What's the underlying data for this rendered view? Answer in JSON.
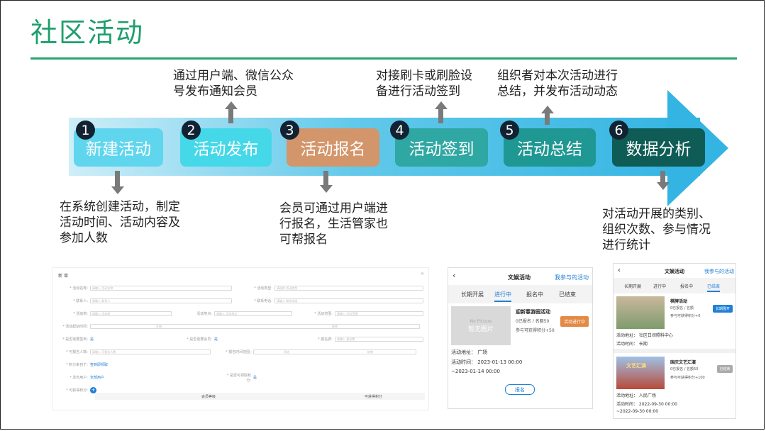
{
  "slide": {
    "title": "社区活动"
  },
  "steps": [
    {
      "num": "1",
      "label": "新建活动",
      "color": "#5fd6ee"
    },
    {
      "num": "2",
      "label": "活动发布",
      "color": "#45d8e8"
    },
    {
      "num": "3",
      "label": "活动报名",
      "color": "#d3956a"
    },
    {
      "num": "4",
      "label": "活动签到",
      "color": "#2fa7a2"
    },
    {
      "num": "5",
      "label": "活动总结",
      "color": "#1f9792"
    },
    {
      "num": "6",
      "label": "数据分析",
      "color": "#0e5c55"
    }
  ],
  "descriptions": {
    "step1": [
      "在系统创建活动，制定",
      "活动时间、活动内容及",
      "参加人数"
    ],
    "step2": [
      "通过用户端、微信公众",
      "号发布通知会员"
    ],
    "step3": [
      "会员可通过用户端进",
      "行报名，生活管家也",
      "可帮报名"
    ],
    "step4": [
      "对接刷卡或刷脸设",
      "备进行活动签到"
    ],
    "step5": [
      "组织者对本次活动进行",
      "总结，并发布活动动态"
    ],
    "step6": [
      "对活动开展的类别、",
      "组织次数、参与情况",
      "进行统计"
    ]
  },
  "form_screenshot": {
    "title": "新 增",
    "fields": [
      {
        "label": "* 活动名称:",
        "placeholder": "请输入 活动名称"
      },
      {
        "label": "* 活动类型:",
        "placeholder": "请选择 活动类型"
      },
      {
        "label": "* 联系人:",
        "placeholder": "请输入 联系人"
      },
      {
        "label": "* 联系电话:",
        "placeholder": "请输入 联系电话"
      },
      {
        "label": "* 活动地:",
        "placeholder": "请输入 活动地"
      },
      {
        "label": "活动地点:",
        "placeholder": "请输入 活动地点"
      },
      {
        "label": "* 活动范围:",
        "placeholder": "请输入 活动范围"
      },
      {
        "label": "* 活动起始时间:",
        "placeholder": "开始"
      },
      {
        "label": "",
        "placeholder": "结束"
      },
      {
        "label": "* 是否需要签到:",
        "placeholder": "是"
      },
      {
        "label": "* 是否需要会员:",
        "placeholder": "是"
      },
      {
        "label": "* 报名费:",
        "placeholder": "请输入 报名费"
      },
      {
        "label": "* 可报名人数:",
        "placeholder": "请输入 可报名人数"
      },
      {
        "label": "* 报名时间范围:",
        "placeholder": "开始"
      },
      {
        "label": "",
        "placeholder": "结束"
      },
      {
        "label": "* 积分来自于:",
        "placeholder": "签到即领取"
      },
      {
        "label": "* 发布用户:",
        "placeholder": "全部用户"
      },
      {
        "label": "* 是否可领取积分:",
        "placeholder": "是"
      },
      {
        "label": "* 可获得积分:",
        "placeholder": ""
      }
    ],
    "table_headers": [
      "会员等级",
      "可获得积分"
    ]
  },
  "mobile1": {
    "header": "文娱活动",
    "link": "我参与的活动",
    "tabs": [
      "长期开展",
      "进行中",
      "报名中",
      "已结束"
    ],
    "active_tab": 1,
    "nopic_en": "No Picture",
    "nopic_cn": "暂无图片",
    "card_title": "迎新春游园活动",
    "card_count": "0已报名 / 名额50",
    "card_points": "参与可获得积分+50",
    "status": "活动进行中",
    "address": "活动地址：  广场",
    "time": "活动时间：  2023-01-13 00:00",
    "time_end": "~2023-01-14 00:00",
    "button": "报名"
  },
  "mobile2": {
    "header": "文娱活动",
    "link": "我参与的活动",
    "tabs": [
      "长期开展",
      "进行中",
      "报名中",
      "已结束"
    ],
    "active_tab": 3,
    "card1_title": "棋牌活动",
    "card1_count": "0已报名 / 名额",
    "card1_points": "参与可获得积分+0",
    "card1_status": "长期展开",
    "card1_address": "活动地址：  社区日间照料中心",
    "card1_time": "活动时间：  长期",
    "card2_title": "国庆文艺汇演",
    "card2_count": "0已报名 / 名额50",
    "card2_points": "参与可获得积分+100",
    "card2_status": "已结束",
    "card2_banner": "文艺汇演",
    "card2_address": "活动地址：  人民广场",
    "card2_time": "活动时间：  2022-09-30 00:00",
    "card2_time_end": "~2022-09-30 00:00"
  }
}
